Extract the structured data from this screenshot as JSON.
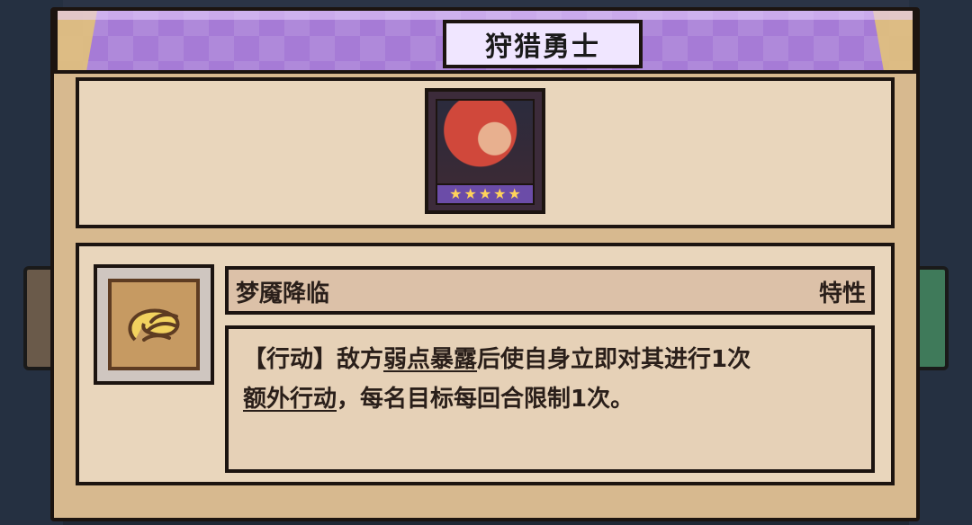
{
  "window": {
    "title": "狩猎勇士"
  },
  "hero": {
    "star_count": 5,
    "star_glyph": "★"
  },
  "trait": {
    "name": "梦魇降临",
    "type": "特性",
    "description": {
      "line1_prefix": "【行动】敌方",
      "line1_underlined": "弱点暴露",
      "line1_suffix": "后使自身立即对其进行1次",
      "line2_underlined": "额外行动",
      "line2_suffix": "，每名目标每回合限制1次。"
    }
  },
  "icons": {
    "trait_icon": "wing-hand-icon",
    "hero_portrait": "hero-portrait"
  },
  "colors": {
    "title_bar": "#a67bd6",
    "panel_brown": "#8a5a3c",
    "card_bg": "#e9d6bc",
    "star": "#ffd35a",
    "stars_bar": "#6b4ca8"
  }
}
